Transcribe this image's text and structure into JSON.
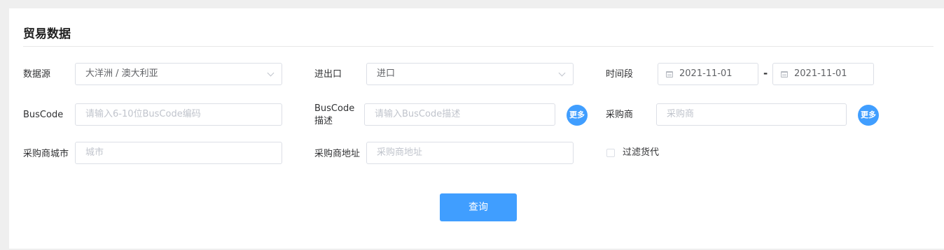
{
  "panel": {
    "title": "贸易数据"
  },
  "form": {
    "data_source": {
      "label": "数据源",
      "value": "大洋洲 / 澳大利亚"
    },
    "import_export": {
      "label": "进出口",
      "value": "进口"
    },
    "time_range": {
      "label": "时间段",
      "start": "2021-11-01",
      "separator": "-",
      "end": "2021-11-01"
    },
    "buscode": {
      "label": "BusCode",
      "placeholder": "请输入6-10位BusCode编码"
    },
    "buscode_desc": {
      "label_line1": "BusCode",
      "label_line2": "描述",
      "placeholder": "请输入BusCode描述",
      "more_label": "更多"
    },
    "purchaser": {
      "label": "采购商",
      "placeholder": "采购商",
      "more_label": "更多"
    },
    "purchaser_city": {
      "label": "采购商城市",
      "placeholder": "城市"
    },
    "purchaser_address": {
      "label": "采购商地址",
      "placeholder": "采购商地址"
    },
    "filter_forwarder": {
      "label": "过滤货代",
      "checked": false
    }
  },
  "actions": {
    "query_label": "查询"
  },
  "colors": {
    "accent": "#409eff",
    "border": "#dcdfe6",
    "placeholder": "#c0c4cc",
    "background": "#efefef"
  },
  "icons": {
    "select": "chevron-down-icon",
    "date": "calendar-icon"
  }
}
